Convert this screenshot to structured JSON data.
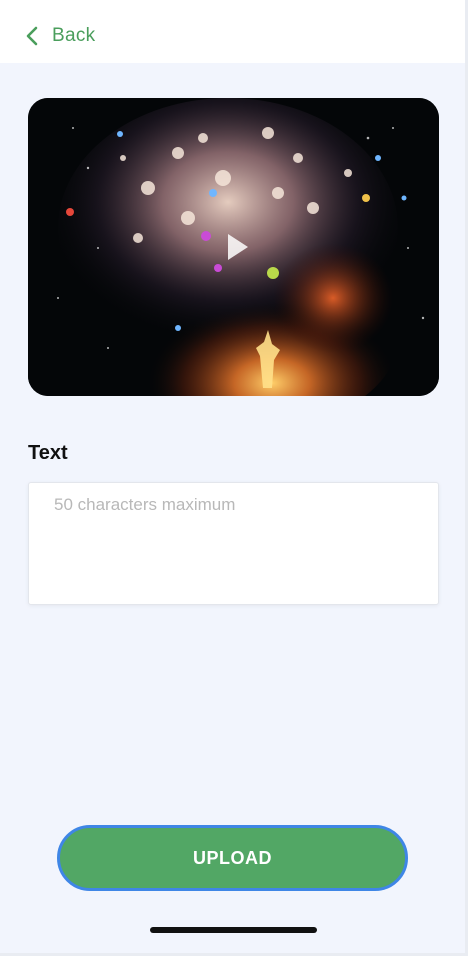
{
  "nav": {
    "back_label": "Back"
  },
  "media": {
    "description_icon": "play-icon"
  },
  "form": {
    "text_label": "Text",
    "text_placeholder": "50 characters maximum"
  },
  "actions": {
    "upload_label": "UPLOAD"
  },
  "colors": {
    "accent_green": "#52a765",
    "upload_border": "#3f86e6",
    "background": "#f2f5fd"
  }
}
